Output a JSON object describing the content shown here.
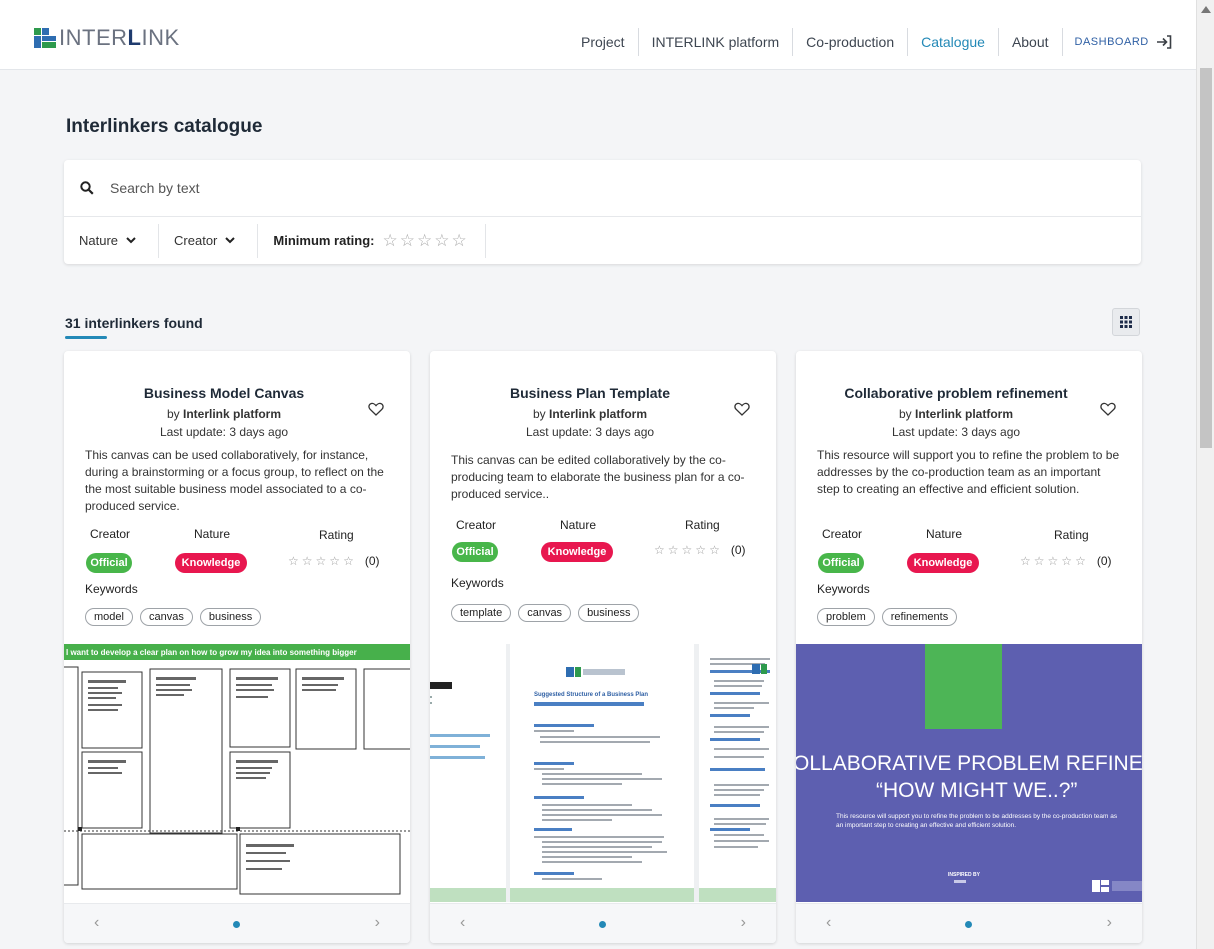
{
  "header": {
    "logo_plain": "INTER",
    "logo_bold": "L",
    "logo_tail": "INK",
    "nav": [
      "Project",
      "INTERLINK platform",
      "Co-production",
      "Catalogue",
      "About"
    ],
    "active_nav": "Catalogue",
    "dashboard_label": "DASHBOARD"
  },
  "page_title": "Interlinkers catalogue",
  "search": {
    "placeholder": "Search by text"
  },
  "filters": {
    "nature_label": "Nature",
    "creator_label": "Creator",
    "min_rating_label": "Minimum rating:",
    "min_rating_value": 0,
    "min_rating_max": 5
  },
  "results": {
    "count_text": "31 interlinkers found"
  },
  "labels": {
    "creator": "Creator",
    "nature": "Nature",
    "rating": "Rating",
    "keywords": "Keywords"
  },
  "cards": [
    {
      "title": "Business Model Canvas",
      "by_prefix": "by",
      "by": "Interlink platform",
      "date": "Last update: 3 days ago",
      "description": "This canvas can be used collaboratively, for instance, during a brainstorming or a focus group, to reflect on the the most suitable business model associated to a co-produced service.",
      "creator_badge": "Official",
      "nature_badge": "Knowledge",
      "rating": 0,
      "rating_count": "(0)",
      "keywords": [
        "model",
        "canvas",
        "business"
      ],
      "preview_text": "I want to develop a clear plan on how to grow my idea into something bigger"
    },
    {
      "title": "Business Plan Template",
      "by_prefix": "by",
      "by": "Interlink platform",
      "date": "Last update: 3 days ago",
      "description": "This canvas can be edited collaboratively by the co-producing team to elaborate the business plan for a co-produced service..",
      "creator_badge": "Official",
      "nature_badge": "Knowledge",
      "rating": 0,
      "rating_count": "(0)",
      "keywords": [
        "template",
        "canvas",
        "business"
      ],
      "preview_text": "Suggested Structure of a Business Plan"
    },
    {
      "title": "Collaborative problem refinement",
      "by_prefix": "by",
      "by": "Interlink platform",
      "date": "Last update: 3 days ago",
      "description": "This resource will support you to refine the problem to be addresses by the co-production team as an important step to creating an effective and efficient solution.",
      "creator_badge": "Official",
      "nature_badge": "Knowledge",
      "rating": 0,
      "rating_count": "(0)",
      "keywords": [
        "problem",
        "refinements"
      ],
      "preview_text": "OLLABORATIVE PROBLEM REFINEME",
      "preview_subtitle": "“HOW MIGHT WE..?”",
      "preview_small": "This resource will support you to refine the problem to be addresses by the co-production team as an important step to creating an effective and efficient solution.",
      "preview_credit": "INSPIRED BY"
    }
  ],
  "colors": {
    "accent": "#2389b7",
    "official": "#48b64a",
    "knowledge": "#e8174f",
    "preview_purple": "#5d5fb0",
    "preview_green": "#4db556"
  }
}
